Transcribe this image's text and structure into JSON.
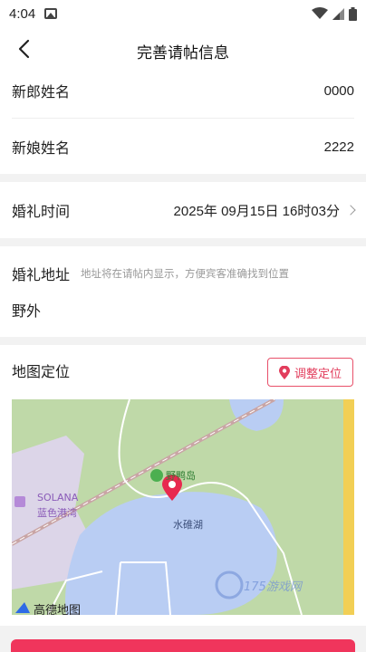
{
  "status_bar": {
    "time": "4:04"
  },
  "nav": {
    "title": "完善请帖信息"
  },
  "form": {
    "groom": {
      "label": "新郎姓名",
      "value": "0000"
    },
    "bride": {
      "label": "新娘姓名",
      "value": "2222"
    },
    "wedding_time": {
      "label": "婚礼时间",
      "value": "2025年 09月15日 16时03分"
    },
    "address": {
      "label": "婚礼地址",
      "hint": "地址将在请帖内显示，方便宾客准确找到位置",
      "value": "野外"
    }
  },
  "map_section": {
    "label": "地图定位",
    "adjust_button": "调整定位",
    "map_labels": {
      "island": "野鸭岛",
      "lake": "水碓湖",
      "solana_en": "SOLANA",
      "solana_zh": "蓝色港湾",
      "brand": "高德地图",
      "watermark": "175游戏网"
    }
  },
  "colors": {
    "accent": "#f0355c",
    "map_water": "#b9cdf3",
    "map_land": "#bfd9a8"
  }
}
